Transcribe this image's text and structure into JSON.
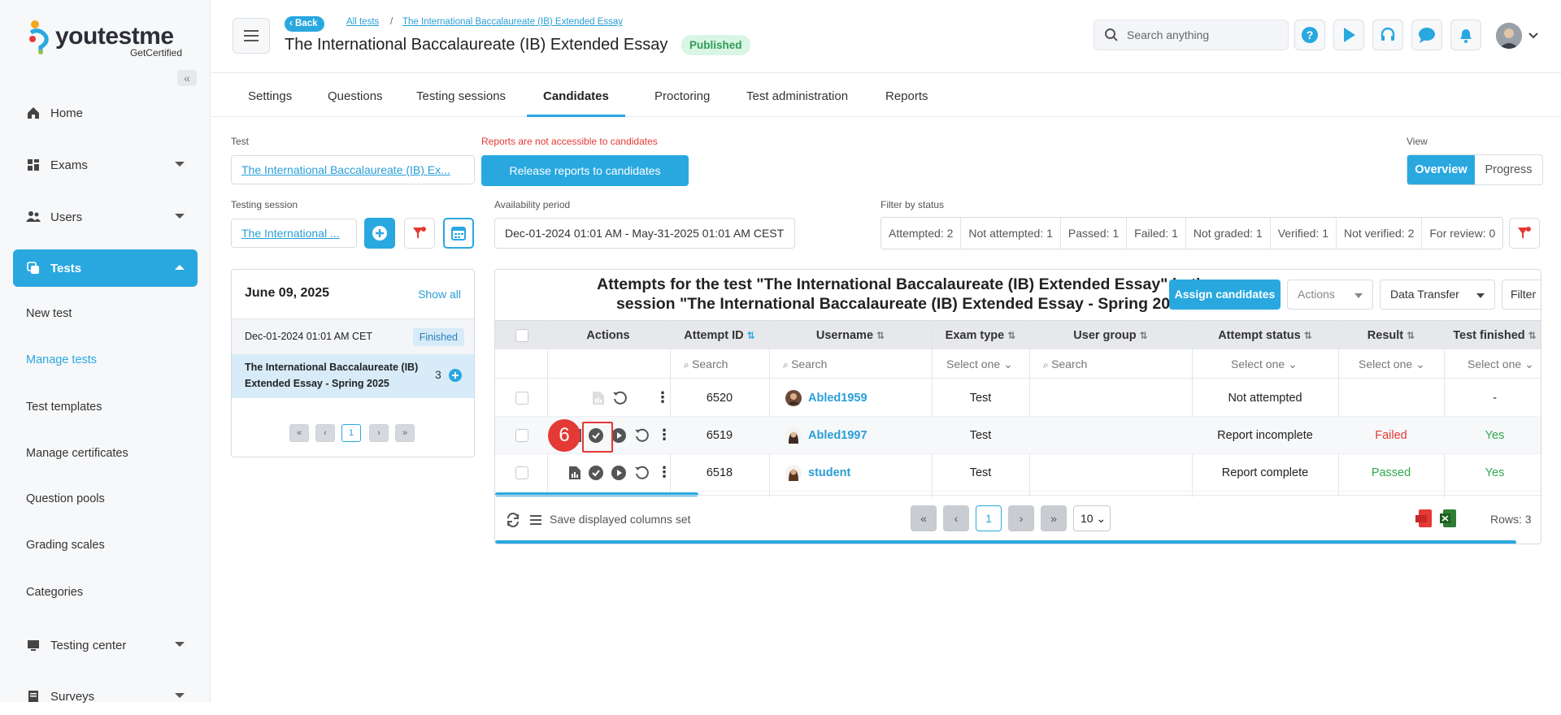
{
  "app": {
    "brand": "youtestme",
    "brand_sub": "GetCertified",
    "accent": "#29a8e0"
  },
  "sidebar": {
    "items": [
      {
        "label": "Home",
        "icon": "home-icon"
      },
      {
        "label": "Exams",
        "icon": "exams-icon"
      },
      {
        "label": "Users",
        "icon": "users-icon"
      },
      {
        "label": "Tests",
        "icon": "tests-icon"
      }
    ],
    "sub_items": [
      "New test",
      "Manage tests",
      "Test templates",
      "Manage certificates",
      "Question pools",
      "Grading scales",
      "Categories"
    ],
    "bottom_items": [
      {
        "label": "Testing center",
        "icon": "testing-center-icon"
      },
      {
        "label": "Surveys",
        "icon": "surveys-icon"
      }
    ]
  },
  "header": {
    "back_label": "Back",
    "crumb_all": "All tests",
    "crumb_sep": "/",
    "crumb_current": "The International Baccalaureate (IB) Extended Essay",
    "title": "The International Baccalaureate (IB) Extended Essay",
    "status_badge": "Published",
    "search_placeholder": "Search anything"
  },
  "tabs": [
    "Settings",
    "Questions",
    "Testing sessions",
    "Candidates",
    "Proctoring",
    "Test administration",
    "Reports"
  ],
  "filters": {
    "test_label": "Test",
    "test_value": "The International Baccalaureate (IB) Ex...",
    "reports_warning": "Reports are not accessible to candidates",
    "release_button": "Release reports to candidates",
    "view_label": "View",
    "view_options": [
      "Overview",
      "Progress"
    ],
    "session_label": "Testing session",
    "session_value": "The International ...",
    "availability_label": "Availability period",
    "availability_value": "Dec-01-2024 01:01 AM - May-31-2025 01:01 AM CEST",
    "status_label": "Filter by status",
    "status_chips": [
      "Attempted: 2",
      "Not attempted: 1",
      "Passed: 1",
      "Failed: 1",
      "Not graded: 1",
      "Verified: 1",
      "Not verified: 2",
      "For review: 0"
    ]
  },
  "session_card": {
    "date": "June 09, 2025",
    "show_all": "Show all",
    "session_time": "Dec-01-2024 01:01 AM CET",
    "session_status": "Finished",
    "session_name_line1": "The International Baccalaureate (IB)",
    "session_name_line2": "Extended Essay - Spring 2025",
    "session_count": "3",
    "page": "1"
  },
  "grid": {
    "title_line1": "Attempts for the test \"The International Baccalaureate (IB) Extended Essay\" in the",
    "title_line2": "session \"The International Baccalaureate (IB) Extended Essay - Spring 2025\"",
    "assign_button": "Assign candidates",
    "actions_button": "Actions",
    "transfer_button": "Data Transfer",
    "filter_button": "Filter",
    "columns": [
      "Actions",
      "Attempt ID",
      "Username",
      "Exam type",
      "User group",
      "Attempt status",
      "Result",
      "Test finished"
    ],
    "search_placeholder": "Search",
    "select_placeholder": "Select one",
    "rows": [
      {
        "attempt_id": "6520",
        "username": "Abled1959",
        "exam_type": "Test",
        "user_group": "",
        "status": "Not attempted",
        "result": "",
        "finished": "-"
      },
      {
        "attempt_id": "6519",
        "username": "Abled1997",
        "exam_type": "Test",
        "user_group": "",
        "status": "Report incomplete",
        "result": "Failed",
        "finished": "Yes"
      },
      {
        "attempt_id": "6518",
        "username": "student",
        "exam_type": "Test",
        "user_group": "",
        "status": "Report complete",
        "result": "Passed",
        "finished": "Yes"
      }
    ],
    "save_columns": "Save displayed columns set",
    "page": "1",
    "page_size": "10",
    "rows_count": "Rows: 3",
    "colors": {
      "failed": "#e53935",
      "passed": "#2faa4f"
    }
  },
  "annotation": {
    "step_number": "6"
  }
}
